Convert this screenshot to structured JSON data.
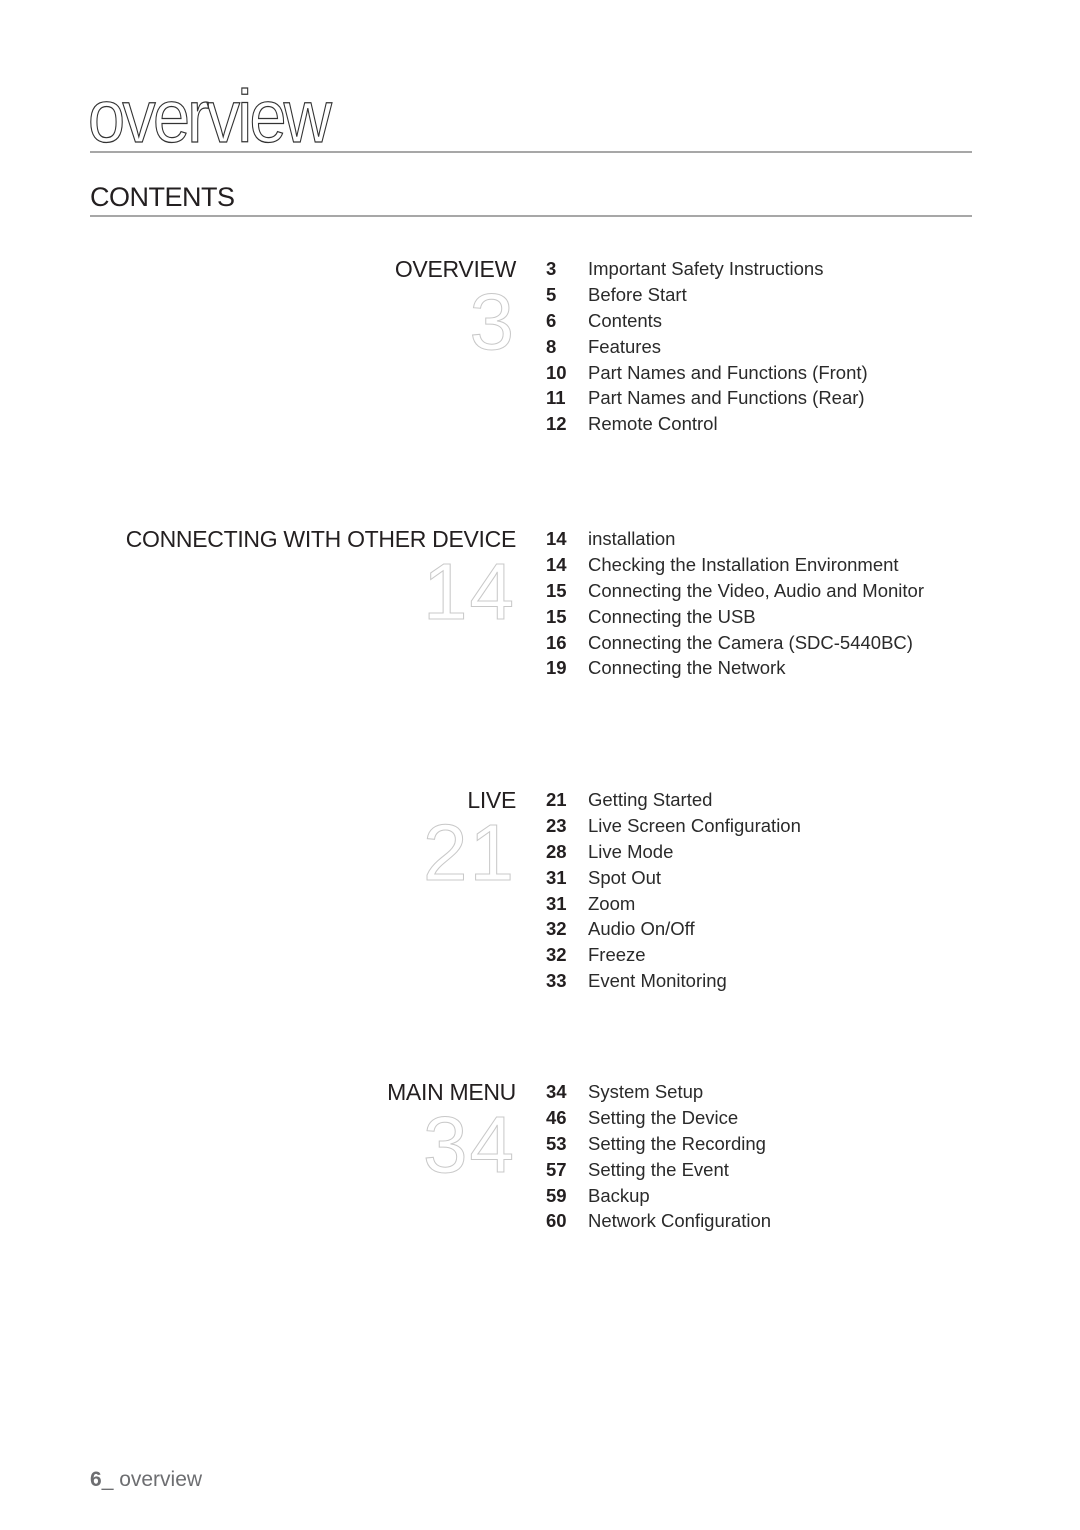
{
  "page": {
    "chapter_title": "overview",
    "heading": "CONTENTS",
    "footer": {
      "page_number": "6",
      "separator": "_ ",
      "label": "overview"
    }
  },
  "sections": [
    {
      "title": "OVERVIEW",
      "start_page": "3",
      "entries": [
        {
          "page": "3",
          "label": "Important Safety Instructions"
        },
        {
          "page": "5",
          "label": "Before Start"
        },
        {
          "page": "6",
          "label": "Contents"
        },
        {
          "page": "8",
          "label": "Features"
        },
        {
          "page": "10",
          "label": "Part Names and Functions (Front)"
        },
        {
          "page": "11",
          "label": "Part Names and Functions (Rear)"
        },
        {
          "page": "12",
          "label": "Remote Control"
        }
      ]
    },
    {
      "title": "CONNECTING WITH OTHER DEVICE",
      "start_page": "14",
      "entries": [
        {
          "page": "14",
          "label": "installation"
        },
        {
          "page": "14",
          "label": "Checking the Installation Environment"
        },
        {
          "page": "15",
          "label": "Connecting the Video, Audio and Monitor"
        },
        {
          "page": "15",
          "label": "Connecting the USB"
        },
        {
          "page": "16",
          "label": "Connecting the Camera (SDC-5440BC)"
        },
        {
          "page": "19",
          "label": "Connecting the Network"
        }
      ]
    },
    {
      "title": "LIVE",
      "start_page": "21",
      "entries": [
        {
          "page": "21",
          "label": "Getting Started"
        },
        {
          "page": "23",
          "label": "Live Screen Configuration"
        },
        {
          "page": "28",
          "label": "Live Mode"
        },
        {
          "page": "31",
          "label": "Spot Out"
        },
        {
          "page": "31",
          "label": "Zoom"
        },
        {
          "page": "32",
          "label": "Audio On/Off"
        },
        {
          "page": "32",
          "label": "Freeze"
        },
        {
          "page": "33",
          "label": "Event Monitoring"
        }
      ]
    },
    {
      "title": "MAIN MENU",
      "start_page": "34",
      "entries": [
        {
          "page": "34",
          "label": "System Setup"
        },
        {
          "page": "46",
          "label": "Setting the Device"
        },
        {
          "page": "53",
          "label": "Setting the Recording"
        },
        {
          "page": "57",
          "label": "Setting the Event"
        },
        {
          "page": "59",
          "label": "Backup"
        },
        {
          "page": "60",
          "label": "Network Configuration"
        }
      ]
    }
  ]
}
